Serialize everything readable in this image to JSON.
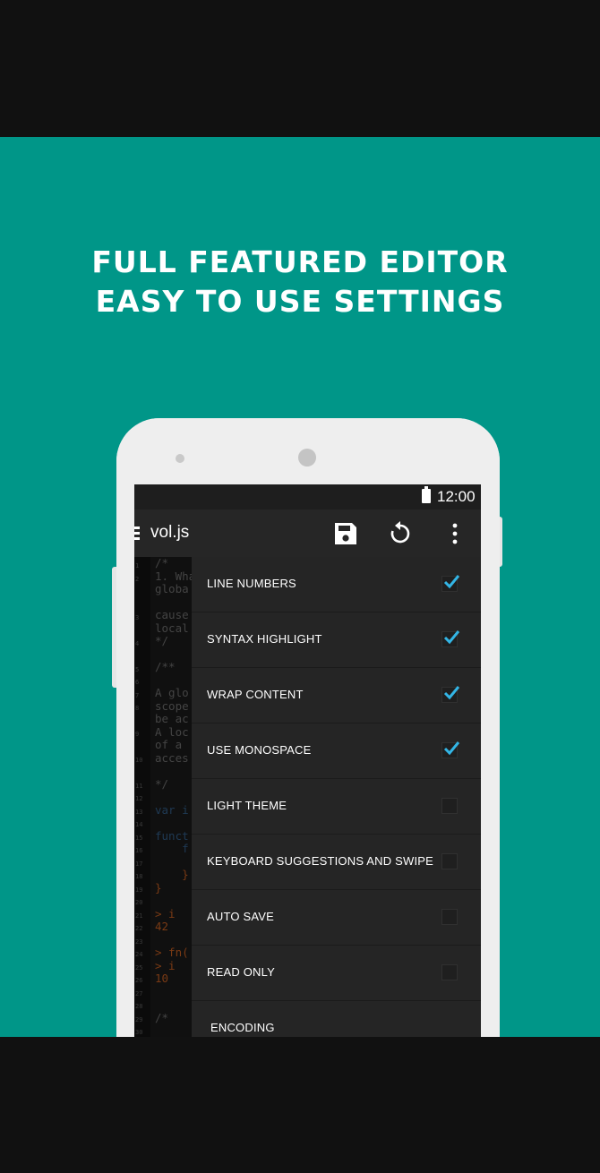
{
  "promo": {
    "line1": "FULL FEATURED EDITOR",
    "line2": "EASY TO USE SETTINGS"
  },
  "status_bar": {
    "time": "12:00"
  },
  "toolbar": {
    "filename": "vol.js",
    "icons": [
      "menu-icon",
      "save-icon",
      "undo-icon",
      "more-icon"
    ]
  },
  "editor": {
    "line_numbers": [
      "1",
      "2",
      "",
      "3",
      "4",
      "",
      "5",
      "6",
      "7",
      "8",
      "9",
      "10",
      "11",
      "",
      "12",
      "13",
      "14",
      "15",
      "16",
      "17",
      "18",
      "19",
      "20",
      "21",
      "22",
      "23",
      "24",
      "25",
      "26",
      "27",
      "28",
      "29",
      "30",
      "31"
    ],
    "code_lines": [
      "/*",
      "1. Wha",
      "globa",
      "",
      "cause",
      "local",
      "*/",
      "",
      "/**",
      "",
      "A glo",
      "scope",
      "be ac",
      "A loc",
      "of a ",
      "acces",
      "",
      "*/",
      "",
      "var i",
      "",
      "funct",
      "    f",
      "",
      "    }",
      "}",
      "",
      "> i",
      "42",
      "",
      "> fn(",
      "> i",
      "10",
      "",
      "",
      "/*"
    ]
  },
  "settings": {
    "items": [
      {
        "label": "LINE NUMBERS",
        "checked": true
      },
      {
        "label": "SYNTAX HIGHLIGHT",
        "checked": true
      },
      {
        "label": "WRAP CONTENT",
        "checked": true
      },
      {
        "label": "USE MONOSPACE",
        "checked": true
      },
      {
        "label": "LIGHT THEME",
        "checked": false
      },
      {
        "label": "KEYBOARD SUGGESTIONS AND SWIPE",
        "checked": false
      },
      {
        "label": "AUTO SAVE",
        "checked": false
      },
      {
        "label": "READ ONLY",
        "checked": false
      }
    ],
    "encoding_label": "ENCODING"
  },
  "colors": {
    "background": "#009688",
    "accent": "#33b5e5",
    "screen": "#1c1c1c"
  }
}
